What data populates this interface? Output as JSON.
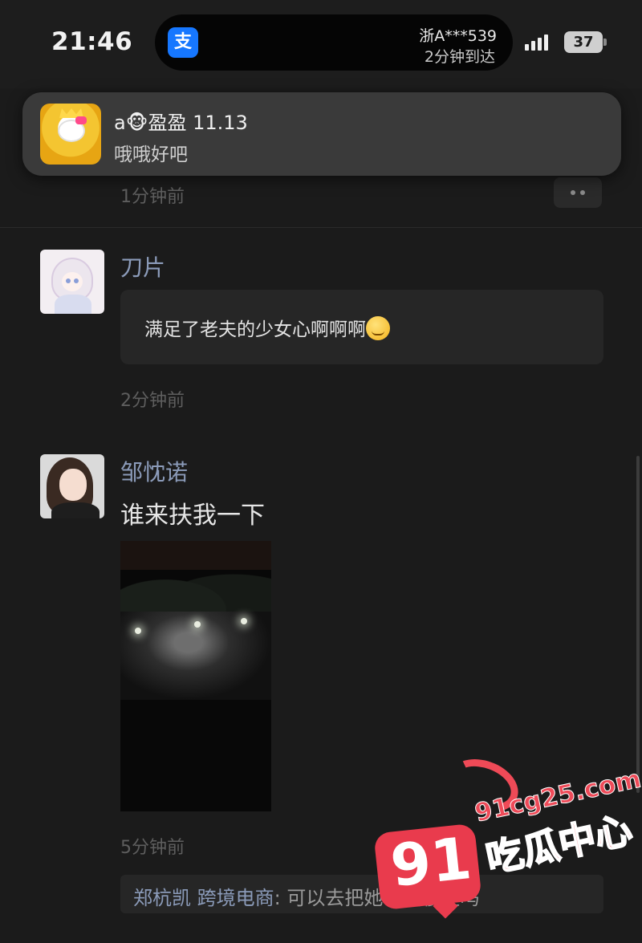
{
  "status_bar": {
    "time": "21:46",
    "island": {
      "app_icon_glyph": "支",
      "plate": "浙A***539",
      "eta": "2分钟到达"
    },
    "signal_icon": "signal-bars-icon",
    "battery": "37"
  },
  "notification": {
    "title": "a🐵盈盈 11.13",
    "body": "哦哦好吧"
  },
  "feed": {
    "first_time": "1分钟前",
    "messages": [
      {
        "sender": "刀片",
        "text": "满足了老夫的少女心啊啊啊",
        "emoji": "relieved-face-emoji",
        "time": "2分钟前"
      },
      {
        "sender": "邹忱诺",
        "text": "谁来扶我一下",
        "image": "night-walkway-photo",
        "time": "5分钟前"
      }
    ],
    "quote": {
      "author": "郑杭凯 跨境电商",
      "text": ": 可以去把她带回寝室吗"
    }
  },
  "watermark": {
    "number": "91",
    "domain": "91cg25.com",
    "brand": "吃瓜中心"
  },
  "colors": {
    "background": "#1b1b1b",
    "bubble": "#262626",
    "sender_name": "#8b9bb9",
    "watermark": "#ee4a58",
    "alipay": "#1677ff"
  }
}
